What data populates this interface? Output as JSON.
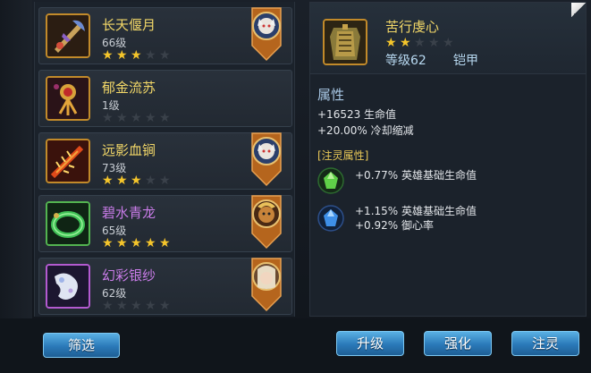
{
  "items": [
    {
      "name": "长天偃月",
      "level": "66级",
      "stars": 3,
      "rarity": "gold",
      "has_hero": true
    },
    {
      "name": "郁金流苏",
      "level": "1级",
      "stars": 0,
      "rarity": "gold",
      "has_hero": false
    },
    {
      "name": "远影血锏",
      "level": "73级",
      "stars": 3,
      "rarity": "gold",
      "has_hero": true
    },
    {
      "name": "碧水青龙",
      "level": "65级",
      "stars": 5,
      "rarity": "purple",
      "has_hero": true
    },
    {
      "name": "幻彩银纱",
      "level": "62级",
      "stars": 0,
      "rarity": "purple",
      "has_hero": true
    }
  ],
  "detail": {
    "name": "苦行虔心",
    "stars": 2,
    "level": "等级62",
    "type": "铠甲",
    "attr_title": "属性",
    "attrs": [
      "+16523 生命值",
      "+20.00% 冷却缩减"
    ],
    "spirit_title": "[注灵属性]",
    "spirit_gem1": [
      "+0.77% 英雄基础生命值"
    ],
    "spirit_gem2": [
      "+1.15% 英雄基础生命值",
      "+0.92% 御心率"
    ]
  },
  "buttons": {
    "filter": "筛选",
    "upgrade": "升级",
    "enhance": "强化",
    "spirit": "注灵"
  },
  "colors": {
    "gold": "#f3d868",
    "purple": "#c97ce8",
    "button_blue": "#2a79b8"
  }
}
